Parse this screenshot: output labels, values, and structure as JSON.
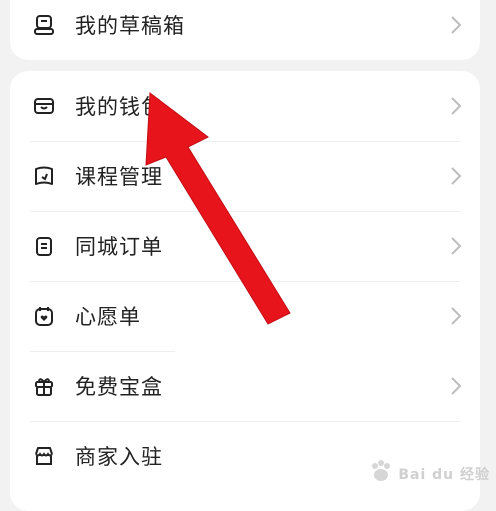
{
  "menu_top": {
    "drafts": "我的草稿箱"
  },
  "menu": {
    "wallet": "我的钱包",
    "courses": "课程管理",
    "local_orders": "同城订单",
    "wishlist": "心愿单",
    "free_box": "免费宝盒",
    "merchant": "商家入驻"
  },
  "watermark": {
    "text": "Bai du 经验"
  },
  "colors": {
    "arrow": "#e8141c",
    "icon": "#222222",
    "chevron": "#bdbdbd"
  }
}
